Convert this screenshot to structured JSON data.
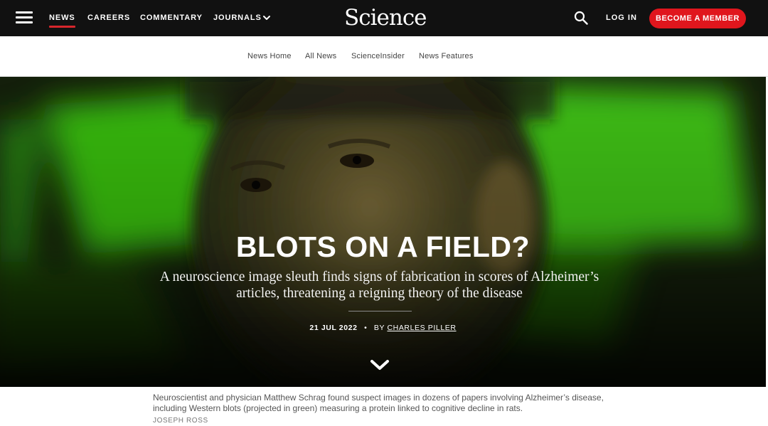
{
  "header": {
    "nav": [
      "NEWS",
      "CAREERS",
      "COMMENTARY",
      "JOURNALS"
    ],
    "logo": "Science",
    "login_label": "LOG IN",
    "member_label": "BECOME A MEMBER",
    "accent_color": "#e0161d",
    "icons": [
      "menu-icon",
      "chevron-down-icon",
      "search-icon"
    ]
  },
  "subnav": [
    "News Home",
    "All News",
    "ScienceInsider",
    "News Features"
  ],
  "hero": {
    "title": "BLOTS ON A FIELD?",
    "subtitle": "A neuroscience image sleuth finds signs of fabrication in scores of Alzheimer’s articles, threatening a reigning theory of the disease",
    "date": "21 JUL 2022",
    "separator": "•",
    "by": "BY",
    "author": "CHARLES PILLER",
    "scroll_icon": "chevron-down-icon"
  },
  "caption": {
    "text": "Neuroscientist and physician Matthew Schrag found suspect images in dozens of papers involving Alzheimer’s disease, including Western blots (projected in green) measuring a protein linked to cognitive decline in rats.",
    "credit": "JOSEPH ROSS"
  }
}
